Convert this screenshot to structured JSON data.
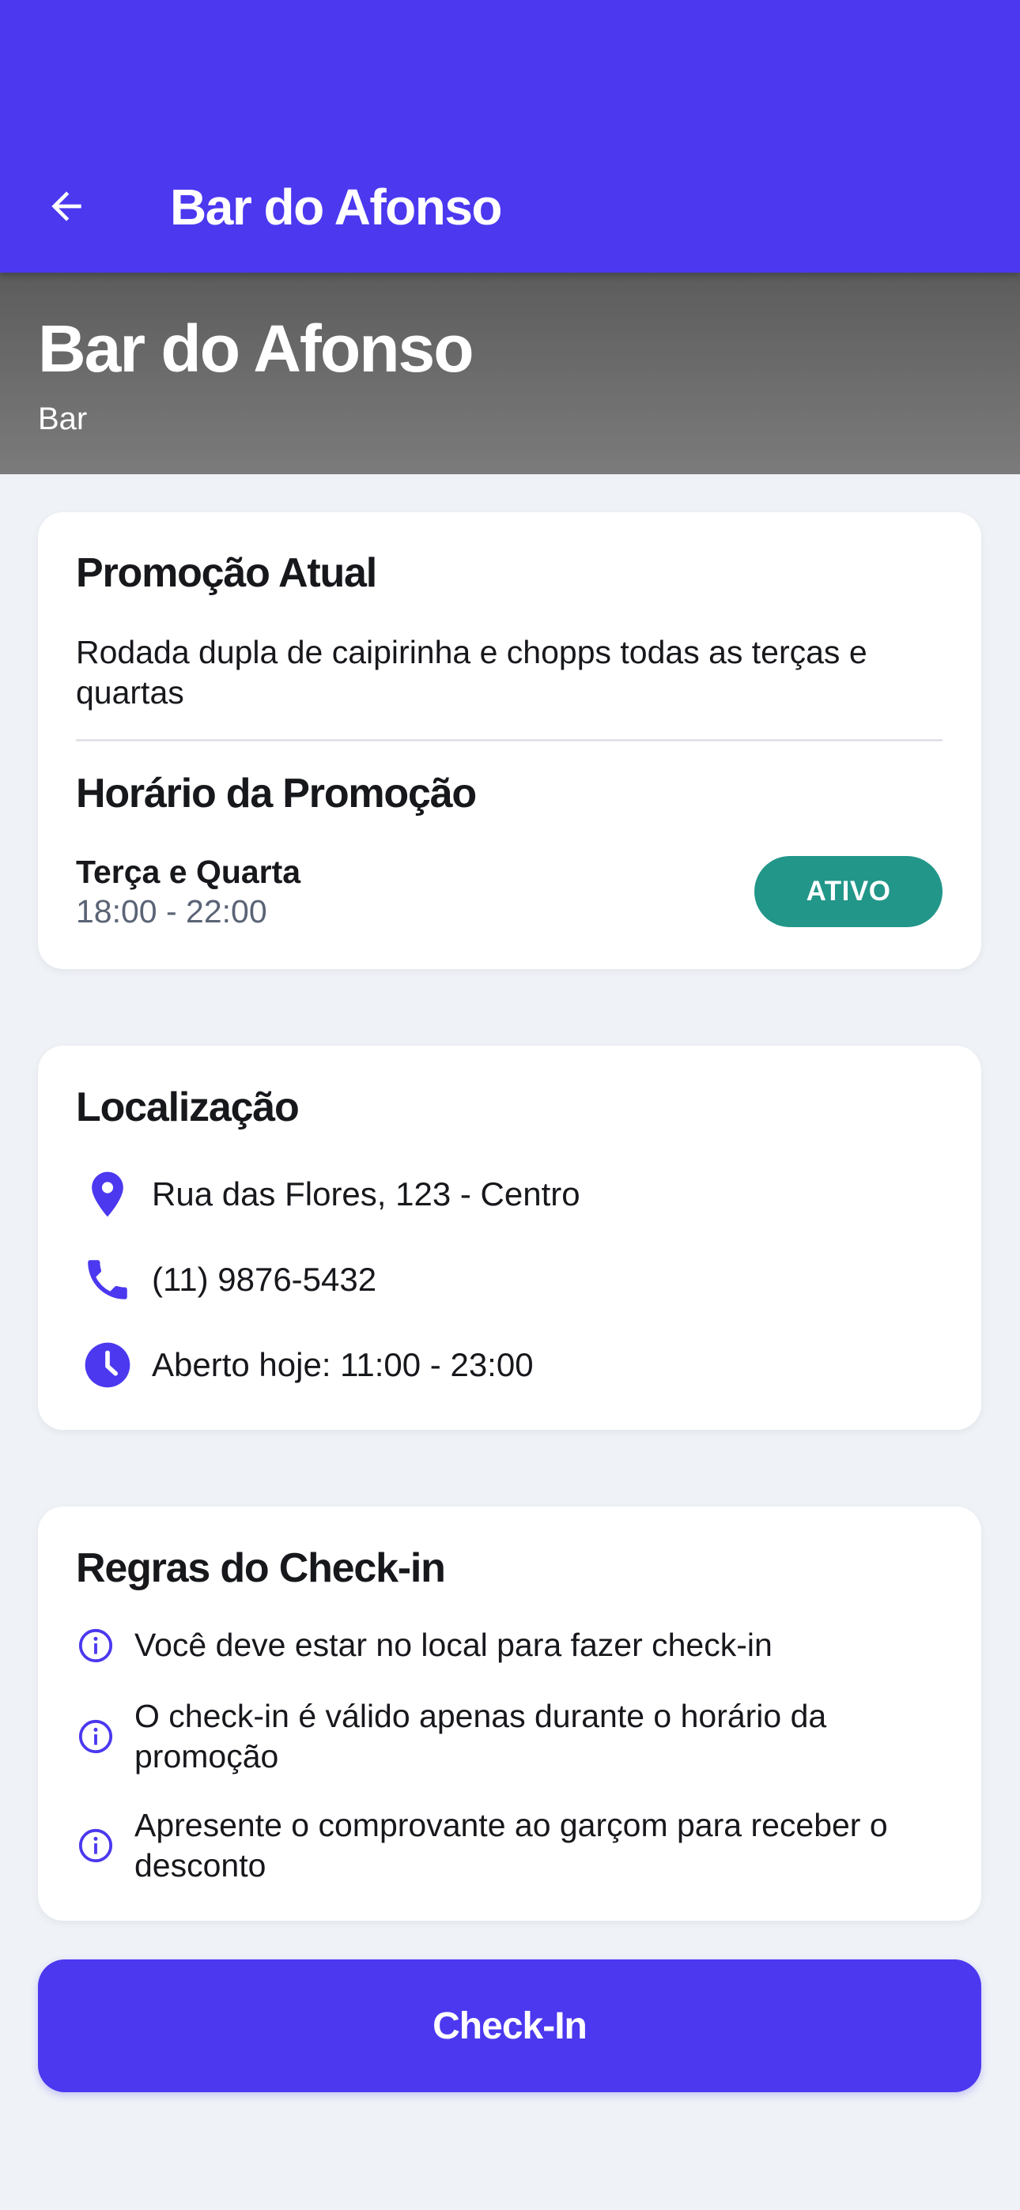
{
  "header": {
    "title": "Bar do Afonso",
    "back_icon": "arrow-left-icon"
  },
  "hero": {
    "title": "Bar do Afonso",
    "subtitle": "Bar"
  },
  "promotion": {
    "heading": "Promoção Atual",
    "description": "Rodada dupla de caipirinha e chopps todas as terças e quartas",
    "schedule_heading": "Horário da Promoção",
    "days": "Terça e Quarta",
    "time": "18:00 - 22:00",
    "status": "ATIVO",
    "status_color": "#219689"
  },
  "location": {
    "heading": "Localização",
    "items": [
      {
        "icon": "location-pin-icon",
        "text": "Rua das Flores, 123 - Centro"
      },
      {
        "icon": "phone-icon",
        "text": "(11) 9876-5432"
      },
      {
        "icon": "clock-icon",
        "text": "Aberto hoje: 11:00 - 23:00"
      }
    ]
  },
  "rules": {
    "heading": "Regras do Check-in",
    "items": [
      {
        "icon": "info-icon",
        "text": "Você deve estar no local para fazer check-in"
      },
      {
        "icon": "info-icon",
        "text": "O check-in é válido apenas durante o horário da promoção"
      },
      {
        "icon": "info-icon",
        "text": "Apresente o comprovante ao garçom para receber o desconto"
      }
    ]
  },
  "cta": {
    "label": "Check-In"
  },
  "colors": {
    "primary": "#4b38ef",
    "background": "#eff2f7",
    "success": "#219689"
  }
}
